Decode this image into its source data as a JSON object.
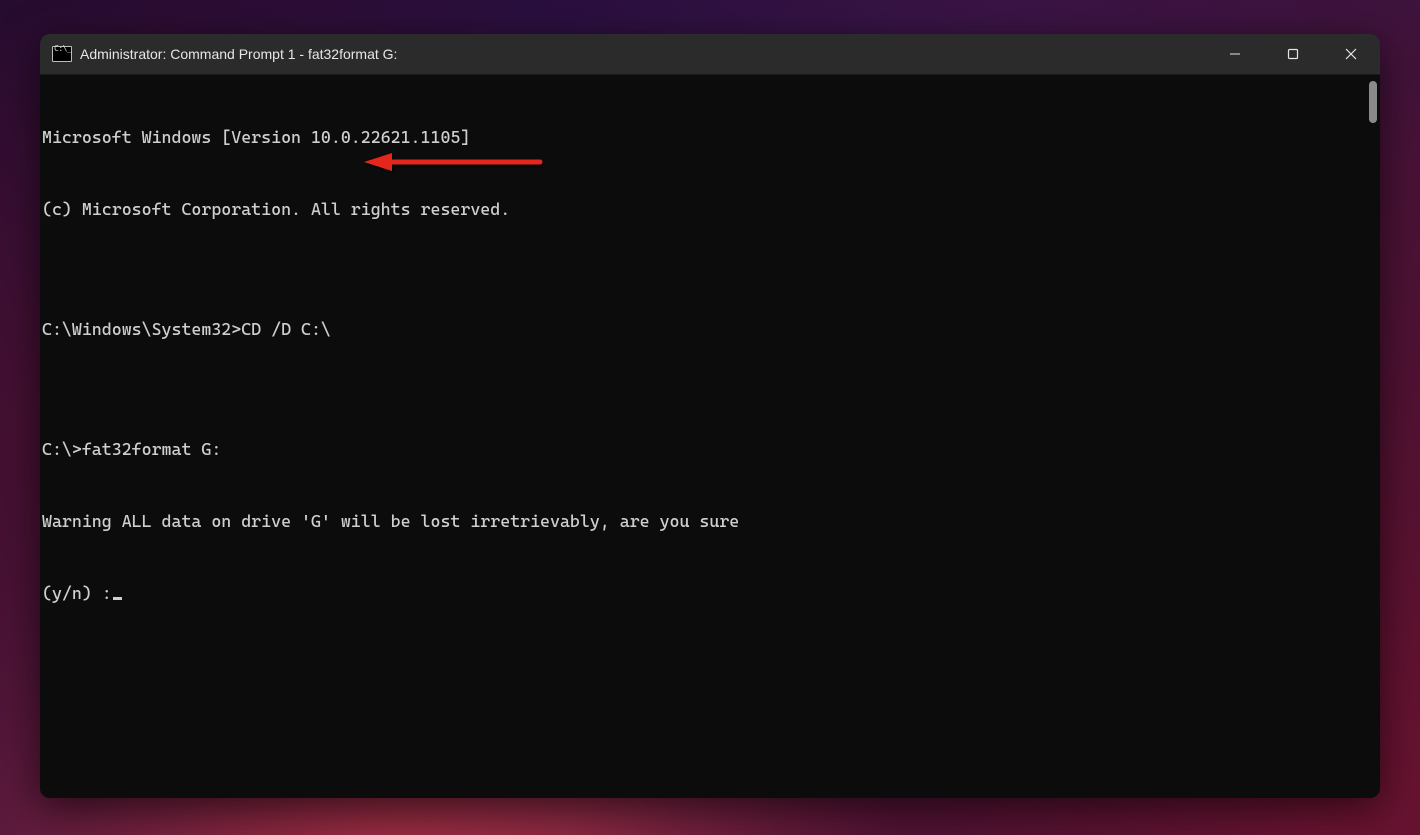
{
  "window": {
    "title": "Administrator: Command Prompt 1 - fat32format  G:"
  },
  "terminal": {
    "lines": [
      "Microsoft Windows [Version 10.0.22621.1105]",
      "(c) Microsoft Corporation. All rights reserved.",
      "",
      "C:\\Windows\\System32>CD /D C:\\",
      "",
      "C:\\>fat32format G:",
      "Warning ALL data on drive 'G' will be lost irretrievably, are you sure",
      "(y/n) :"
    ]
  },
  "annotation": {
    "arrow_color": "#e5261a"
  }
}
